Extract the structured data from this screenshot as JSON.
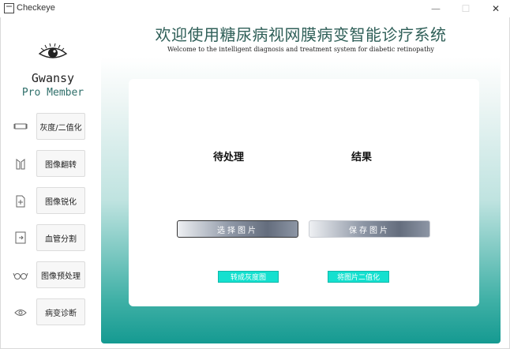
{
  "window": {
    "title": "Checkeye",
    "minimize_glyph": "—",
    "maximize_glyph": "☐",
    "close_glyph": "✕"
  },
  "brand": {
    "name": "Gwansy",
    "tier": "Pro Member",
    "logo_icon": "eye-icon"
  },
  "sidebar": {
    "items": [
      {
        "label": "灰度/二值化",
        "icon": "rectangle-icon"
      },
      {
        "label": "图像翻转",
        "icon": "flip-icon"
      },
      {
        "label": "图像锐化",
        "icon": "sharpen-icon"
      },
      {
        "label": "血管分割",
        "icon": "segment-icon"
      },
      {
        "label": "图像预处理",
        "icon": "glasses-icon"
      },
      {
        "label": "病变诊断",
        "icon": "eye-icon"
      }
    ]
  },
  "header": {
    "title": "欢迎使用糖尿病视网膜病变智能诊疗系统",
    "subtitle": "Welcome to the intelligent diagnosis and treatment system for diabetic retinopathy"
  },
  "main": {
    "pending_label": "待处理",
    "result_label": "结果",
    "choose_image_label": "选择图片",
    "save_image_label": "保存图片",
    "to_grayscale_label": "转成灰度图",
    "binarize_label": "将图片二值化"
  },
  "colors": {
    "accent": "#14e0cf",
    "title": "#2f5f58",
    "panel_bottom": "#159a91"
  }
}
